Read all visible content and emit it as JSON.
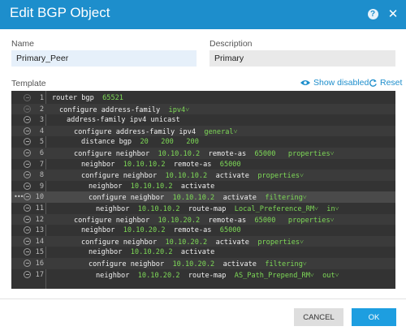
{
  "dialog": {
    "title": "Edit BGP Object"
  },
  "form": {
    "name_label": "Name",
    "name_value": "Primary_Peer",
    "description_label": "Description",
    "description_value": "Primary",
    "template_label": "Template",
    "show_disabled_label": "Show disabled",
    "reset_label": "Reset"
  },
  "editor_lines": [
    {
      "n": "1",
      "indent": 0,
      "parts": [
        [
          "t",
          "router bgp  "
        ],
        [
          "g",
          "65521"
        ]
      ]
    },
    {
      "n": "2",
      "indent": 1,
      "parts": [
        [
          "t",
          "configure address-family  "
        ],
        [
          "g",
          "ipv4"
        ],
        [
          "d",
          "˅"
        ]
      ]
    },
    {
      "n": "3",
      "indent": 2,
      "parts": [
        [
          "t",
          "address-family ipv4 unicast"
        ]
      ]
    },
    {
      "n": "4",
      "indent": 3,
      "parts": [
        [
          "t",
          "configure address-family ipv4  "
        ],
        [
          "g",
          "general"
        ],
        [
          "d",
          "˅"
        ]
      ]
    },
    {
      "n": "5",
      "indent": 4,
      "parts": [
        [
          "t",
          "distance bgp  "
        ],
        [
          "g",
          "20   200   200"
        ]
      ]
    },
    {
      "n": "6",
      "indent": 3,
      "parts": [
        [
          "t",
          "configure neighbor  "
        ],
        [
          "g",
          "10.10.10.2"
        ],
        [
          "t",
          "  remote-as  "
        ],
        [
          "g",
          "65000"
        ],
        [
          "t",
          "   "
        ],
        [
          "g",
          "properties"
        ],
        [
          "d",
          "˅"
        ]
      ]
    },
    {
      "n": "7",
      "indent": 4,
      "parts": [
        [
          "t",
          "neighbor  "
        ],
        [
          "g",
          "10.10.10.2"
        ],
        [
          "t",
          "  remote-as  "
        ],
        [
          "g",
          "65000"
        ]
      ]
    },
    {
      "n": "8",
      "indent": 4,
      "parts": [
        [
          "t",
          "configure neighbor  "
        ],
        [
          "g",
          "10.10.10.2"
        ],
        [
          "t",
          "  activate  "
        ],
        [
          "g",
          "properties"
        ],
        [
          "d",
          "˅"
        ]
      ]
    },
    {
      "n": "9",
      "indent": 5,
      "parts": [
        [
          "t",
          "neighbor  "
        ],
        [
          "g",
          "10.10.10.2"
        ],
        [
          "t",
          "  activate"
        ]
      ]
    },
    {
      "n": "10",
      "indent": 5,
      "parts": [
        [
          "t",
          "configure neighbor  "
        ],
        [
          "g",
          "10.10.10.2"
        ],
        [
          "t",
          "  activate  "
        ],
        [
          "g",
          "filtering"
        ],
        [
          "d",
          "˅"
        ]
      ]
    },
    {
      "n": "11",
      "indent": 6,
      "parts": [
        [
          "t",
          "neighbor  "
        ],
        [
          "g",
          "10.10.10.2"
        ],
        [
          "t",
          "  route-map  "
        ],
        [
          "g",
          "Local_Preference_RM"
        ],
        [
          "d",
          "˅"
        ],
        [
          "t",
          "  "
        ],
        [
          "g",
          "in"
        ],
        [
          "d",
          "˅"
        ]
      ]
    },
    {
      "n": "12",
      "indent": 3,
      "parts": [
        [
          "t",
          "configure neighbor  "
        ],
        [
          "g",
          "10.10.20.2"
        ],
        [
          "t",
          "  remote-as  "
        ],
        [
          "g",
          "65000"
        ],
        [
          "t",
          "   "
        ],
        [
          "g",
          "properties"
        ],
        [
          "d",
          "˅"
        ]
      ]
    },
    {
      "n": "13",
      "indent": 4,
      "parts": [
        [
          "t",
          "neighbor  "
        ],
        [
          "g",
          "10.10.20.2"
        ],
        [
          "t",
          "  remote-as  "
        ],
        [
          "g",
          "65000"
        ]
      ]
    },
    {
      "n": "14",
      "indent": 4,
      "parts": [
        [
          "t",
          "configure neighbor  "
        ],
        [
          "g",
          "10.10.20.2"
        ],
        [
          "t",
          "  activate  "
        ],
        [
          "g",
          "properties"
        ],
        [
          "d",
          "˅"
        ]
      ]
    },
    {
      "n": "15",
      "indent": 5,
      "parts": [
        [
          "t",
          "neighbor  "
        ],
        [
          "g",
          "10.10.20.2"
        ],
        [
          "t",
          "  activate"
        ]
      ]
    },
    {
      "n": "16",
      "indent": 5,
      "parts": [
        [
          "t",
          "configure neighbor  "
        ],
        [
          "g",
          "10.10.20.2"
        ],
        [
          "t",
          "  activate  "
        ],
        [
          "g",
          "filtering"
        ],
        [
          "d",
          "˅"
        ]
      ]
    },
    {
      "n": "17",
      "indent": 6,
      "parts": [
        [
          "t",
          "neighbor  "
        ],
        [
          "g",
          "10.10.20.2"
        ],
        [
          "t",
          "  route-map  "
        ],
        [
          "g",
          "AS_Path_Prepend_RM"
        ],
        [
          "d",
          "˅"
        ],
        [
          "t",
          "  "
        ],
        [
          "g",
          "out"
        ],
        [
          "d",
          "˅"
        ]
      ]
    }
  ],
  "actions": {
    "cancel_label": "CANCEL",
    "ok_label": "OK"
  },
  "colors": {
    "header": "#1d8ecc",
    "ok": "#1d9ee0",
    "code_value": "#7ed957"
  }
}
